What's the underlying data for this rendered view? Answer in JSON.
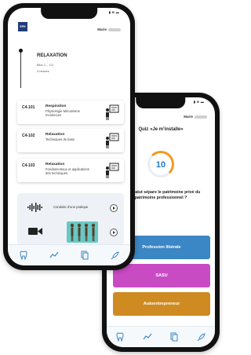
{
  "back_phone": {
    "user_name": "Marie",
    "quiz_title": "Quiz «Je m'installe»",
    "timer_value": "10",
    "question": "Quel statut sépare le patrimoine privé du patrimoine professionnel ?",
    "answers": [
      {
        "label": "Profession libérale",
        "color": "#3b86c4"
      },
      {
        "label": "SASU",
        "color": "#c94bc4"
      },
      {
        "label": "Autoentrepreneur",
        "color": "#cf8a22"
      }
    ],
    "tabs": [
      "tooth-icon",
      "chart-icon",
      "documents-icon",
      "rocket-icon"
    ]
  },
  "front_phone": {
    "user_name": "Marie",
    "logo_text": "EPH",
    "module": {
      "title": "RELAXATION",
      "blocs": "Bloc 1 – C4",
      "duration": "4 heures"
    },
    "courses": [
      {
        "code": "C4-101",
        "title": "Respiration",
        "desc": "Physiologie Mécanisme Incidences"
      },
      {
        "code": "C4-102",
        "title": "Relaxation",
        "desc": "Techniques de base"
      },
      {
        "code": "C4-103",
        "title": "Relaxation",
        "desc": "Fondamentaux et applications des techniques"
      }
    ],
    "media": {
      "audio_label": "Conduite d'une pratique"
    },
    "tabs": [
      "tooth-icon",
      "chart-icon",
      "documents-icon",
      "rocket-icon"
    ]
  }
}
